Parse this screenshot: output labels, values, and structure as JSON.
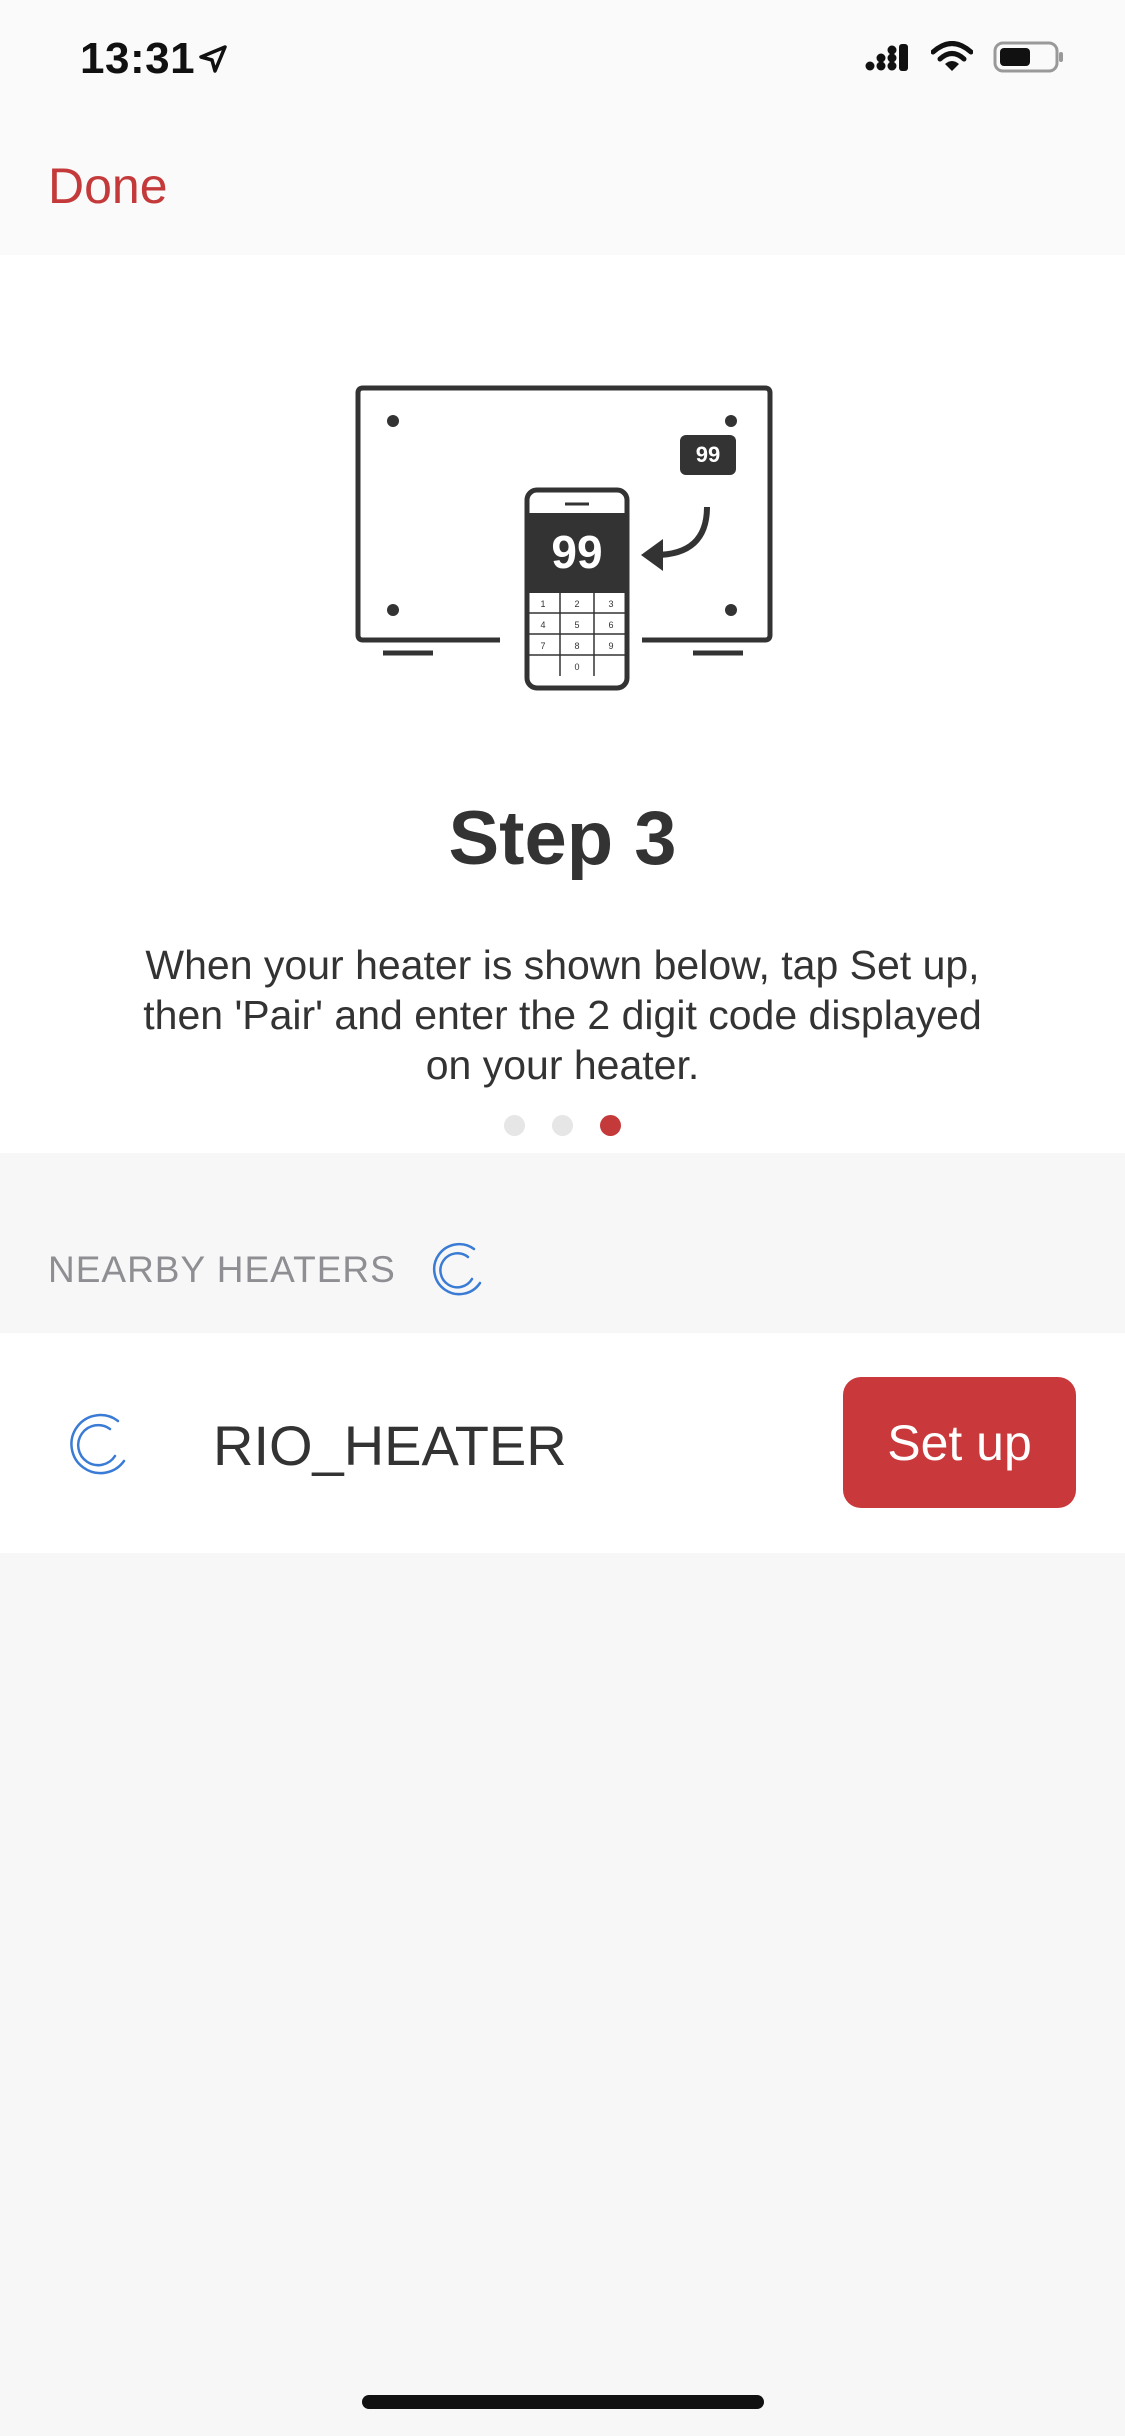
{
  "status_bar": {
    "time": "13:31",
    "icons": [
      "location-arrow-icon",
      "cellular-signal-icon",
      "wifi-icon",
      "battery-icon"
    ]
  },
  "nav": {
    "done_label": "Done"
  },
  "illustration": {
    "heater_code": "99",
    "phone_code": "99",
    "keypad": [
      "1",
      "2",
      "3",
      "4",
      "5",
      "6",
      "7",
      "8",
      "9",
      "0"
    ]
  },
  "step": {
    "title": "Step 3",
    "description": "When your heater is shown below, tap Set up, then 'Pair' and enter the 2 digit code displayed on your heater.",
    "page_count": 3,
    "current_page": 3
  },
  "nearby": {
    "header": "NEARBY HEATERS",
    "heaters": [
      {
        "name": "RIO_HEATER",
        "action_label": "Set up"
      }
    ]
  },
  "colors": {
    "accent": "#c4393a",
    "spinner": "#3a7bd5",
    "background": "#f7f7f7"
  }
}
